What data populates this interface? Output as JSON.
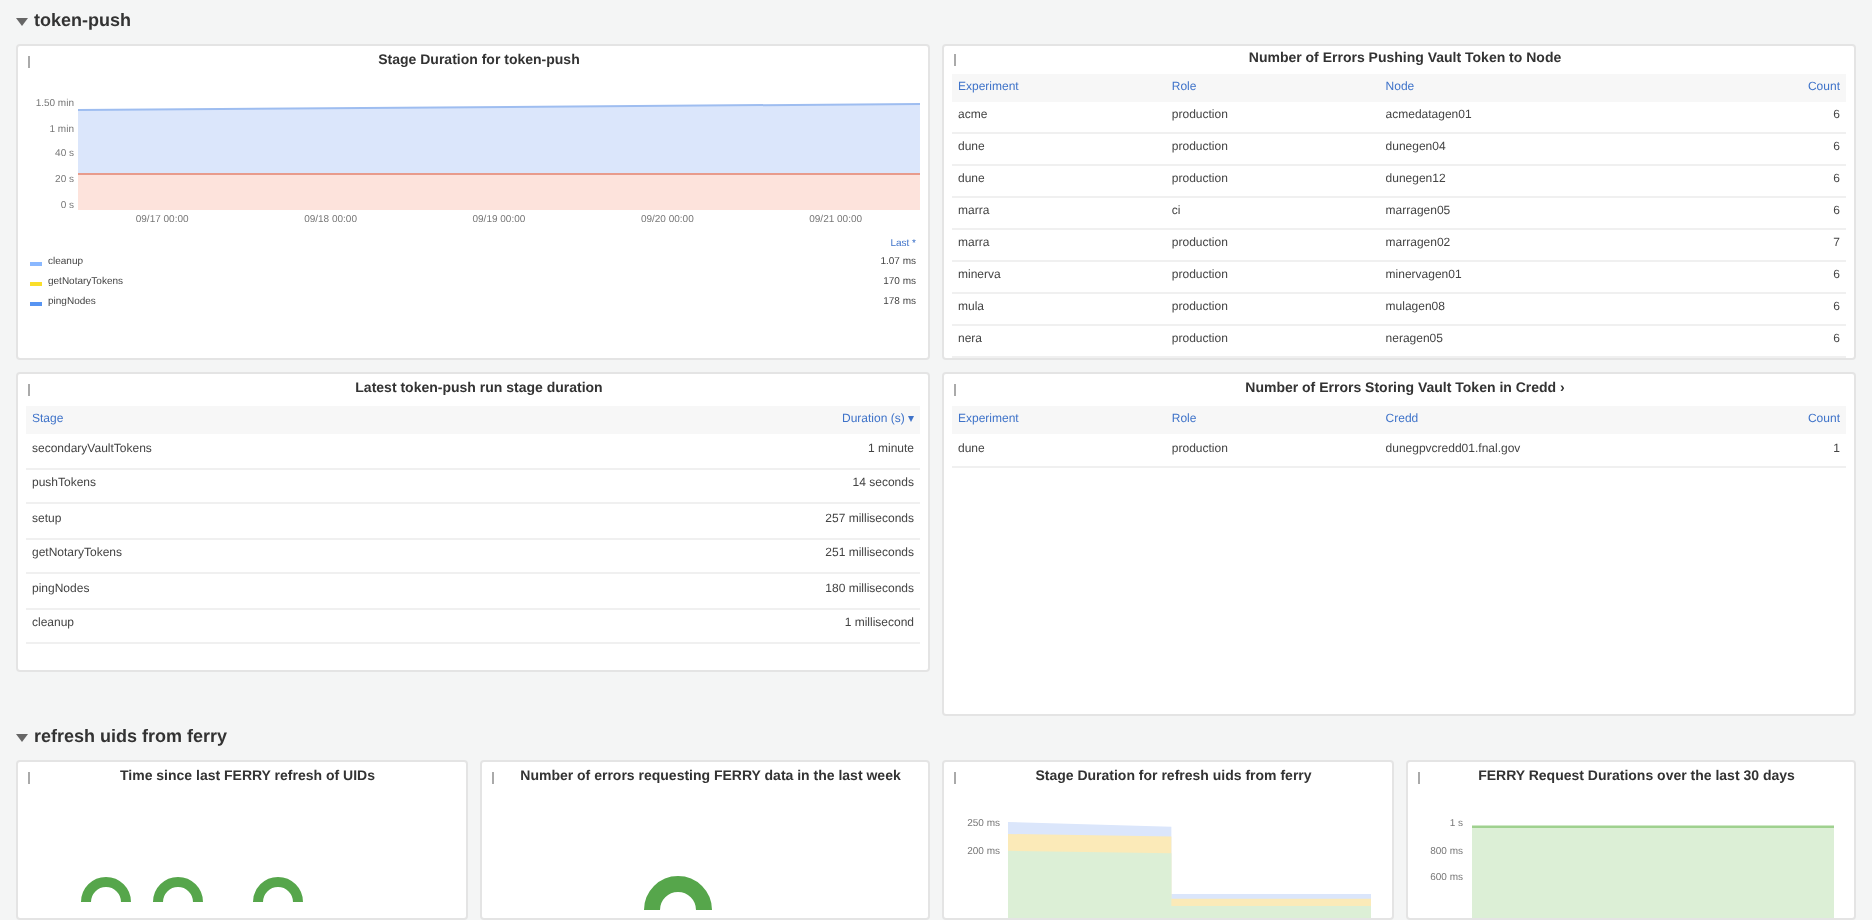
{
  "rows": [
    {
      "title": "token-push",
      "expanded": true
    },
    {
      "title": "refresh uids from ferry",
      "expanded": true
    }
  ],
  "stage_duration_panel": {
    "title": "Stage Duration for token-push",
    "y_labels": [
      "1.50 min",
      "1 min",
      "40 s",
      "20 s",
      "0 s"
    ],
    "x_labels": [
      "09/17 00:00",
      "09/18 00:00",
      "09/19 00:00",
      "09/20 00:00",
      "09/21 00:00"
    ],
    "legend_header": "Last *",
    "legend": [
      {
        "name": "cleanup",
        "value": "1.07 ms",
        "color": "#8ab8ff"
      },
      {
        "name": "getNotaryTokens",
        "value": "170 ms",
        "color": "#fade2a"
      },
      {
        "name": "pingNodes",
        "value": "178 ms",
        "color": "#5794f2"
      }
    ]
  },
  "push_errors_panel": {
    "title": "Number of Errors Pushing Vault Token to Node",
    "columns": [
      "Experiment",
      "Role",
      "Node",
      "Count"
    ],
    "rows": [
      [
        "acme",
        "production",
        "acmedatagen01",
        "6"
      ],
      [
        "dune",
        "production",
        "dunegen04",
        "6"
      ],
      [
        "dune",
        "production",
        "dunegen12",
        "6"
      ],
      [
        "marra",
        "ci",
        "marragen05",
        "6"
      ],
      [
        "marra",
        "production",
        "marragen02",
        "7"
      ],
      [
        "minerva",
        "production",
        "minervagen01",
        "6"
      ],
      [
        "mula",
        "production",
        "mulagen08",
        "6"
      ],
      [
        "nera",
        "production",
        "neragen05",
        "6"
      ]
    ]
  },
  "latest_run_panel": {
    "title": "Latest token-push run stage duration",
    "columns": [
      "Stage",
      "Duration (s) ▾"
    ],
    "rows": [
      [
        "secondaryVaultTokens",
        "1 minute"
      ],
      [
        "pushTokens",
        "14 seconds"
      ],
      [
        "setup",
        "257 milliseconds"
      ],
      [
        "getNotaryTokens",
        "251 milliseconds"
      ],
      [
        "pingNodes",
        "180 milliseconds"
      ],
      [
        "cleanup",
        "1 millisecond"
      ]
    ]
  },
  "store_errors_panel": {
    "title": "Number of Errors Storing Vault Token in Credd ›",
    "columns": [
      "Experiment",
      "Role",
      "Credd",
      "Count"
    ],
    "rows": [
      [
        "dune",
        "production",
        "dunegpvcredd01.fnal.gov",
        "1"
      ]
    ]
  },
  "ferry_panels": [
    {
      "kind": "stat",
      "title": "Time since last FERRY refresh of UIDs"
    },
    {
      "kind": "gauge",
      "title": "Number of errors requesting FERRY data in the last week"
    },
    {
      "kind": "stages",
      "title": "Stage Duration for refresh uids from ferry",
      "y_labels": [
        "250 ms",
        "200 ms"
      ]
    },
    {
      "kind": "area",
      "title": "FERRY Request Durations over the last 30 days",
      "y_labels": [
        "1 s",
        "800 ms",
        "600 ms"
      ]
    }
  ]
}
